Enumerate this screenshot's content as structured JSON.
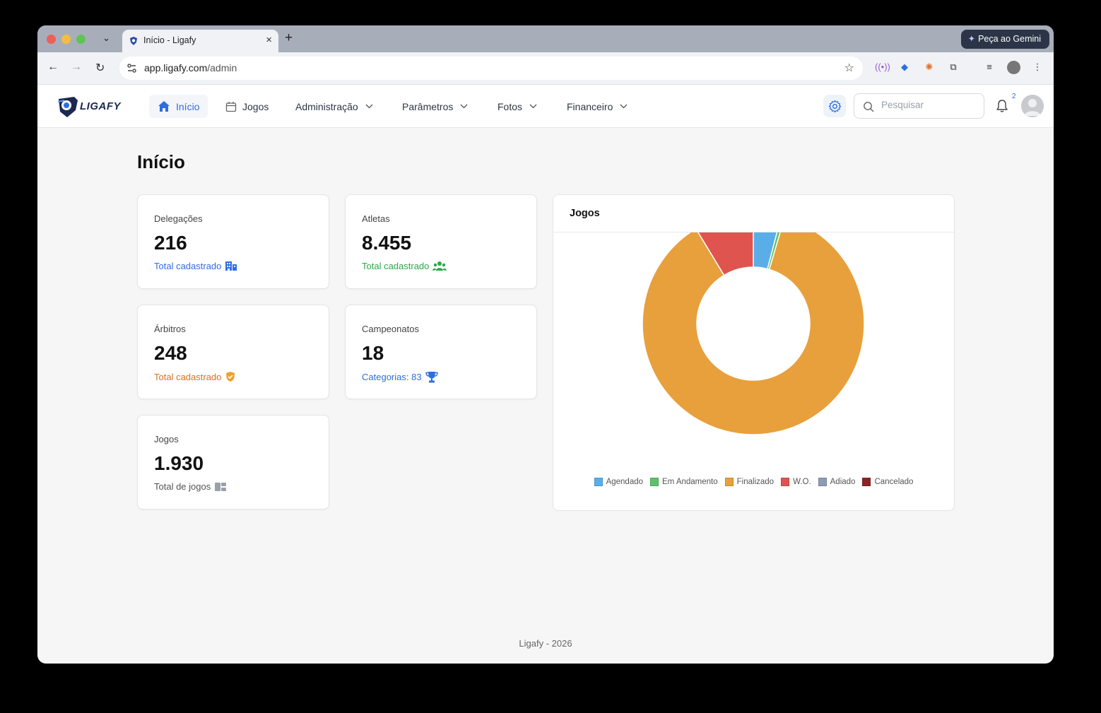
{
  "browser": {
    "tab_title": "Início - Ligafy",
    "url_host": "app.ligafy.com",
    "url_path": "/admin",
    "gemini_label": "Peça ao Gemini"
  },
  "header": {
    "brand": "LIGAFY",
    "nav": [
      {
        "label": "Início",
        "active": true
      },
      {
        "label": "Jogos"
      },
      {
        "label": "Administração"
      },
      {
        "label": "Parâmetros"
      },
      {
        "label": "Fotos"
      },
      {
        "label": "Financeiro"
      }
    ],
    "search_placeholder": "Pesquisar",
    "notification_count": "2"
  },
  "page": {
    "title": "Início",
    "cards": [
      {
        "label": "Delegações",
        "value": "216",
        "sub": "Total cadastrado",
        "icon": "building-icon",
        "color": "#2f6ee0"
      },
      {
        "label": "Atletas",
        "value": "8.455",
        "sub": "Total cadastrado",
        "icon": "users-icon",
        "color": "#2aa84a"
      },
      {
        "label": "Árbitros",
        "value": "248",
        "sub": "Total cadastrado",
        "icon": "shield-check-icon",
        "color": "#d9731a"
      },
      {
        "label": "Campeonatos",
        "value": "18",
        "sub": "Categorias: 83",
        "icon": "trophy-icon",
        "color": "#2f6ee0"
      },
      {
        "label": "Jogos",
        "value": "1.930",
        "sub": "Total de jogos",
        "icon": "games-icon",
        "color": "#555555"
      }
    ],
    "chart_title": "Jogos",
    "footer": "Ligafy - 2026"
  },
  "chart_data": {
    "type": "pie",
    "categories": [
      "Agendado",
      "Em Andamento",
      "Finalizado",
      "W.O.",
      "Adiado",
      "Cancelado"
    ],
    "values": [
      78,
      10,
      1675,
      167,
      0,
      0
    ],
    "colors": [
      "#5aaee8",
      "#5cc26a",
      "#e8a03c",
      "#e0544f",
      "#8c9cb3",
      "#8f2424"
    ],
    "legend": "bottom"
  }
}
